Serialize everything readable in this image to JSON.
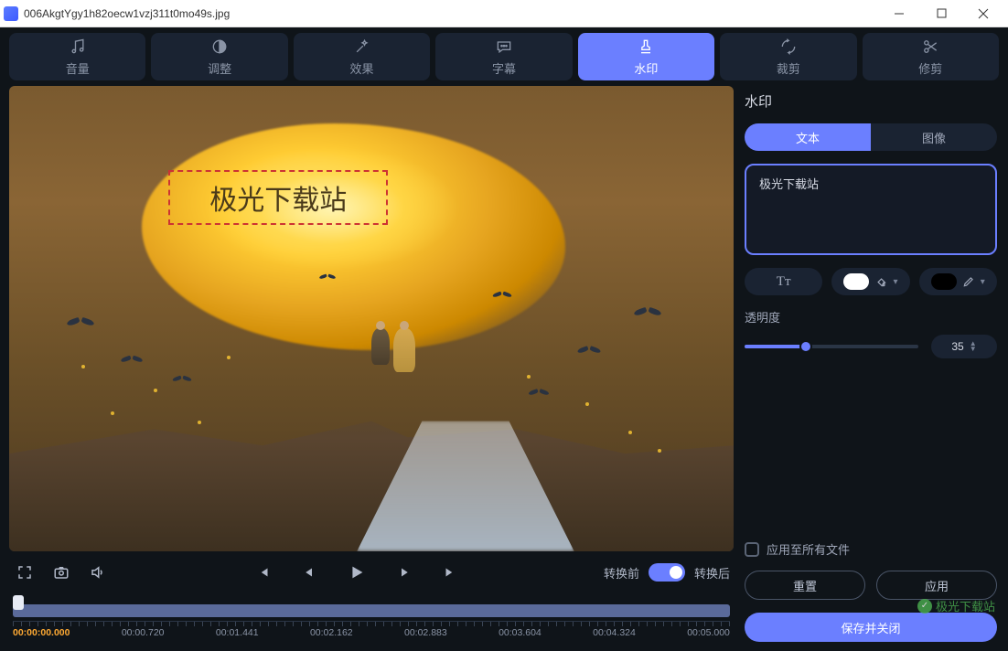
{
  "titlebar": {
    "filename": "006AkgtYgy1h82oecw1vzj311t0mo49s.jpg"
  },
  "toolbar": {
    "items": [
      {
        "label": "音量",
        "icon": "volume"
      },
      {
        "label": "调整",
        "icon": "adjust"
      },
      {
        "label": "效果",
        "icon": "effect"
      },
      {
        "label": "字幕",
        "icon": "subtitle"
      },
      {
        "label": "水印",
        "icon": "watermark",
        "active": true
      },
      {
        "label": "裁剪",
        "icon": "crop"
      },
      {
        "label": "修剪",
        "icon": "trim"
      }
    ]
  },
  "watermark_overlay_text": "极光下载站",
  "playback": {
    "before_label": "转换前",
    "after_label": "转换后"
  },
  "timeline": {
    "current": "00:00:00.000",
    "ticks": [
      "00:00.720",
      "00:01.441",
      "00:02.162",
      "00:02.883",
      "00:03.604",
      "00:04.324",
      "00:05.000"
    ]
  },
  "panel": {
    "title": "水印",
    "tabs": {
      "text": "文本",
      "image": "图像"
    },
    "input_value": "极光下载站",
    "opacity_label": "透明度",
    "opacity_value": "35",
    "apply_all_label": "应用至所有文件",
    "reset_label": "重置",
    "apply_label": "应用",
    "save_close_label": "保存并关闭",
    "font_glyph": "Tᴛ",
    "fill_color": "#ffffff",
    "stroke_color": "#000000"
  },
  "brand_text": "极光下载站"
}
